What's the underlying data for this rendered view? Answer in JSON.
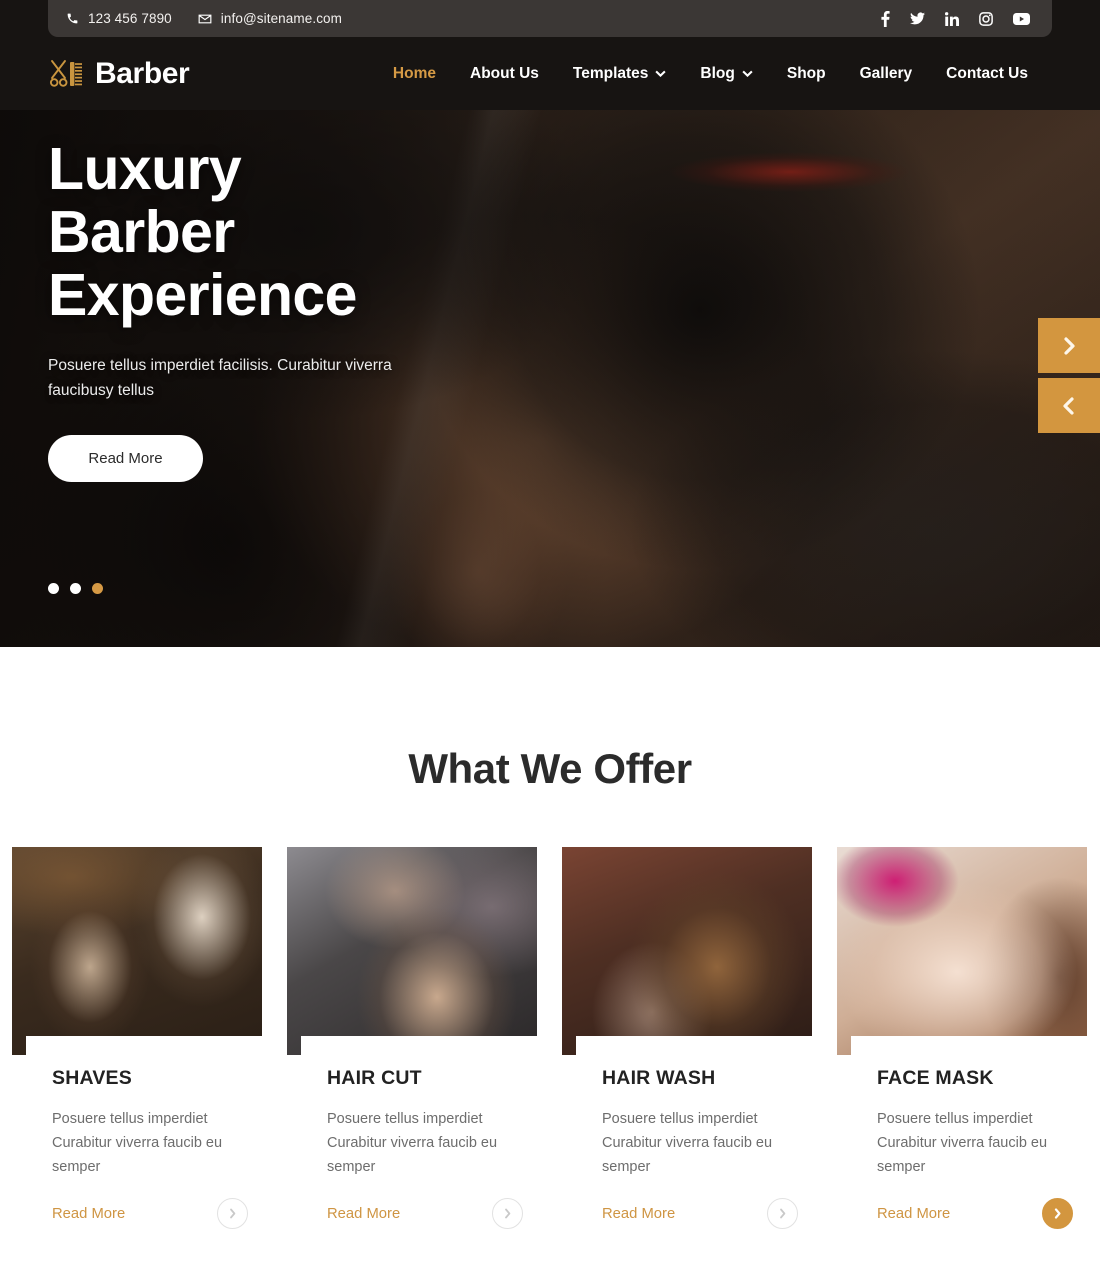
{
  "topbar": {
    "phone": "123 456 7890",
    "email": "info@sitename.com",
    "phone_icon": "phone-icon",
    "email_icon": "envelope-icon",
    "social": [
      {
        "name": "facebook-icon",
        "label": "Facebook"
      },
      {
        "name": "twitter-icon",
        "label": "Twitter"
      },
      {
        "name": "linkedin-icon",
        "label": "LinkedIn"
      },
      {
        "name": "instagram-icon",
        "label": "Instagram"
      },
      {
        "name": "youtube-icon",
        "label": "YouTube"
      }
    ]
  },
  "brand": {
    "name": "Barber",
    "logo_icon": "scissors-comb-icon"
  },
  "nav": {
    "items": [
      {
        "label": "Home",
        "active": true,
        "dropdown": false
      },
      {
        "label": "About Us",
        "active": false,
        "dropdown": false
      },
      {
        "label": "Templates",
        "active": false,
        "dropdown": true
      },
      {
        "label": "Blog",
        "active": false,
        "dropdown": true
      },
      {
        "label": "Shop",
        "active": false,
        "dropdown": false
      },
      {
        "label": "Gallery",
        "active": false,
        "dropdown": false
      },
      {
        "label": "Contact Us",
        "active": false,
        "dropdown": false
      }
    ]
  },
  "hero": {
    "title": "Luxury\nBarber\nExperience",
    "subtitle": "Posuere tellus imperdiet facilisis. Curabitur viverra faucibusy tellus",
    "button_label": "Read More",
    "slide_count": 3,
    "active_slide": 3,
    "next_label": "Next slide",
    "prev_label": "Previous slide"
  },
  "offer": {
    "heading": "What We Offer",
    "cards": [
      {
        "title": "SHAVES",
        "text": "Posuere tellus imperdiet Curabitur viverra faucib eu semper",
        "link_label": "Read More",
        "arrow_filled": false,
        "image_alt": "barber shaving bearded client"
      },
      {
        "title": "HAIR CUT",
        "text": "Posuere tellus imperdiet Curabitur viverra faucib eu semper",
        "link_label": "Read More",
        "arrow_filled": false,
        "image_alt": "barber cutting young man hair with clippers"
      },
      {
        "title": "HAIR WASH",
        "text": "Posuere tellus imperdiet Curabitur viverra faucib eu semper",
        "link_label": "Read More",
        "arrow_filled": false,
        "image_alt": "man with styled hair against brick wall"
      },
      {
        "title": "FACE MASK",
        "text": "Posuere tellus imperdiet Curabitur viverra faucib eu semper",
        "link_label": "Read More",
        "arrow_filled": true,
        "image_alt": "woman receiving facial treatment"
      }
    ]
  },
  "colors": {
    "accent_gold": "#d3963f",
    "nav_active": "#d69a45",
    "header_dark": "#171412",
    "topbar_gray": "#3b3735",
    "heading_dark": "#2b2b2b",
    "body_gray": "#6d6d6d",
    "link_gold": "#cf9543"
  }
}
